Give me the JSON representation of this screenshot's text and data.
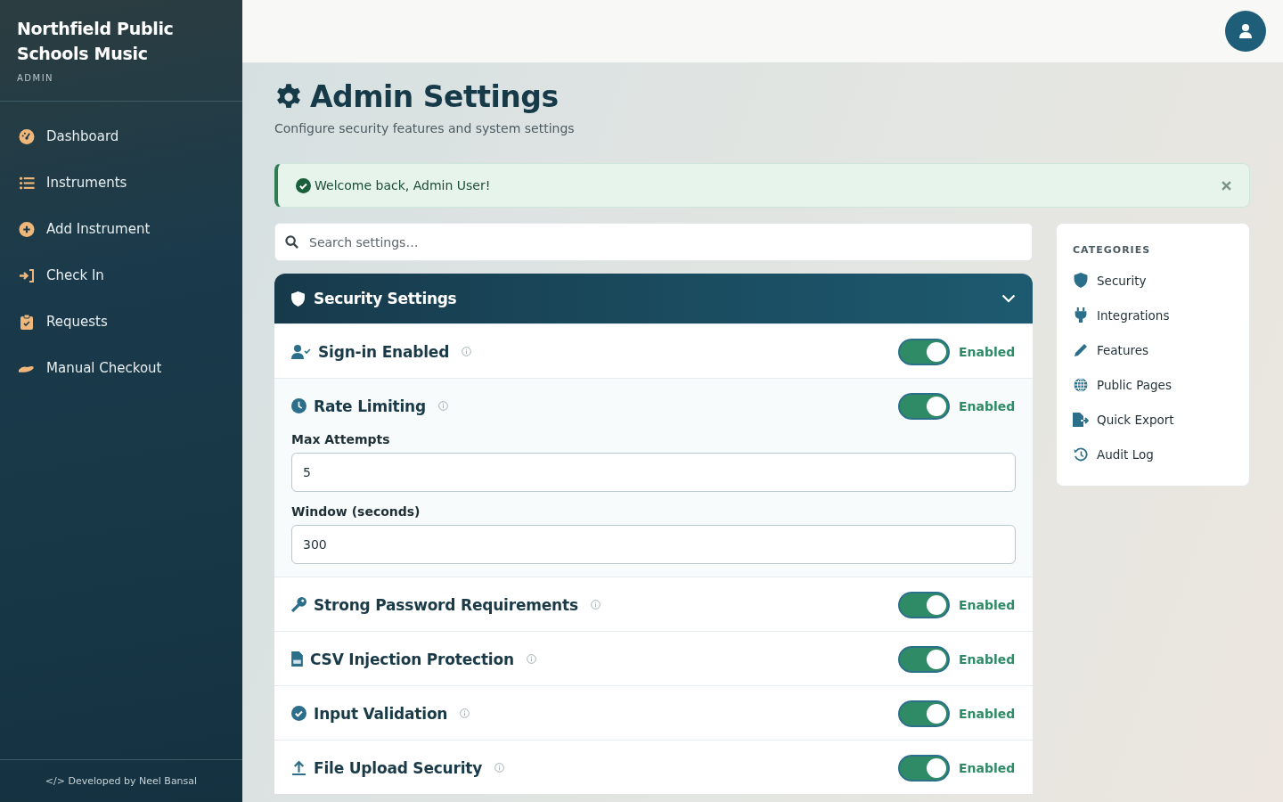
{
  "sidebar": {
    "brand": "Northfield Public Schools Music",
    "role": "ADMIN",
    "items": [
      {
        "label": "Dashboard"
      },
      {
        "label": "Instruments"
      },
      {
        "label": "Add Instrument"
      },
      {
        "label": "Check In"
      },
      {
        "label": "Requests"
      },
      {
        "label": "Manual Checkout"
      }
    ],
    "footer": "</> Developed by Neel Bansal"
  },
  "page": {
    "title": "Admin Settings",
    "subtitle": "Configure security features and system settings"
  },
  "alert": {
    "message": "Welcome back, Admin User!"
  },
  "search": {
    "placeholder": "Search settings…"
  },
  "section": {
    "title": "Security Settings",
    "expanded": true,
    "settings": [
      {
        "title": "Sign-in Enabled",
        "on": true,
        "status": "Enabled"
      },
      {
        "title": "Rate Limiting",
        "on": true,
        "status": "Enabled",
        "fields": [
          {
            "label": "Max Attempts",
            "value": "5"
          },
          {
            "label": "Window (seconds)",
            "value": "300"
          }
        ]
      },
      {
        "title": "Strong Password Requirements",
        "on": true,
        "status": "Enabled"
      },
      {
        "title": "CSV Injection Protection",
        "on": true,
        "status": "Enabled"
      },
      {
        "title": "Input Validation",
        "on": true,
        "status": "Enabled"
      },
      {
        "title": "File Upload Security",
        "on": true,
        "status": "Enabled"
      }
    ]
  },
  "categories": {
    "title": "CATEGORIES",
    "items": [
      {
        "label": "Security"
      },
      {
        "label": "Integrations"
      },
      {
        "label": "Features"
      },
      {
        "label": "Public Pages"
      },
      {
        "label": "Quick Export"
      },
      {
        "label": "Audit Log"
      }
    ]
  }
}
